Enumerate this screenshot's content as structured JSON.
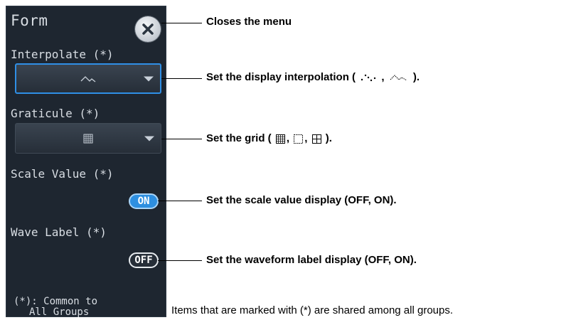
{
  "panel": {
    "title": "Form",
    "close_icon": "close-icon",
    "interpolate": {
      "label": "Interpolate (*)",
      "value_icon": "line-interpolation-icon"
    },
    "graticule": {
      "label": "Graticule (*)",
      "value_icon": "grid-icon"
    },
    "scale_value": {
      "label": "Scale Value (*)",
      "state": "ON"
    },
    "wave_label": {
      "label": "Wave Label (*)",
      "state": "OFF"
    },
    "footnote": {
      "line1": "(*): Common to",
      "line2": "All Groups"
    }
  },
  "callouts": {
    "close": "Closes the menu",
    "interp_pre": "Set the display interpolation (",
    "interp_sep": ",",
    "interp_post": ").",
    "grid_pre": "Set the grid (",
    "grid_post": ").",
    "scale": "Set the scale value display (OFF, ON).",
    "wave": "Set the waveform label display (OFF, ON)."
  },
  "note": "Items that are marked with (*) are shared among all groups.",
  "colors": {
    "panel_bg": "#1e2630",
    "accent_blue": "#2f8fe6",
    "text": "#d9dee4"
  }
}
